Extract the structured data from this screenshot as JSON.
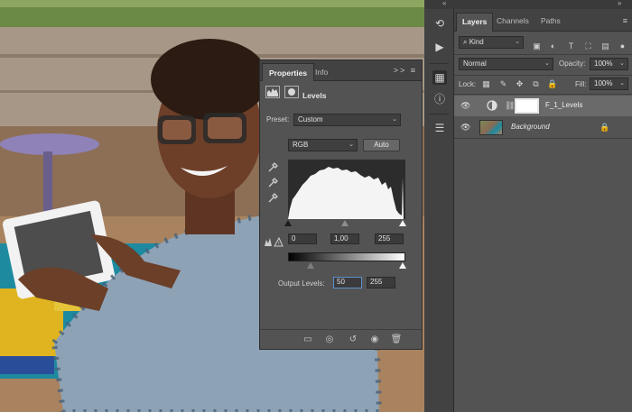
{
  "properties": {
    "tabs": [
      "Properties",
      "Info"
    ],
    "menu_icon": ">> ≡",
    "title": "Levels",
    "preset_label": "Preset:",
    "preset_value": "Custom",
    "channel_value": "RGB",
    "auto_label": "Auto",
    "input_black": "0",
    "input_gamma": "1,00",
    "input_white": "255",
    "output_label": "Output Levels:",
    "output_black": "50",
    "output_white": "255"
  },
  "toolstrip": {
    "collapse_left": "«",
    "collapse_right": "»"
  },
  "layers_panel": {
    "tabs": [
      "Layers",
      "Channels",
      "Paths"
    ],
    "kind_label": "Kind",
    "blend_mode": "Normal",
    "opacity_label": "Opacity:",
    "opacity_value": "100%",
    "lock_label": "Lock:",
    "fill_label": "Fill:",
    "fill_value": "100%",
    "layers": [
      {
        "name": "F_1_Levels",
        "selected": true
      },
      {
        "name": "Background",
        "selected": false
      }
    ]
  },
  "icons": {
    "eye": "eye-icon",
    "link": "chain-link-icon",
    "lock": "lock-icon"
  }
}
